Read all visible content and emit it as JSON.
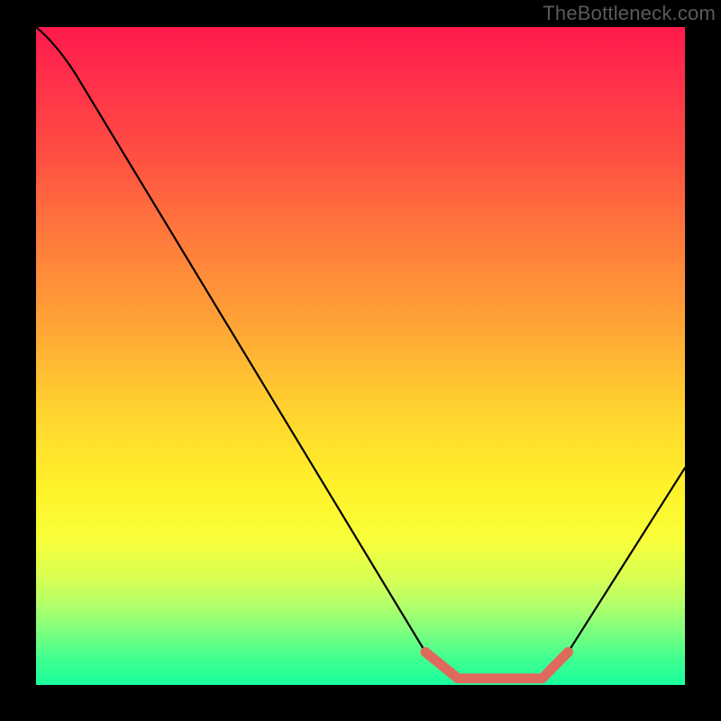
{
  "watermark": "TheBottleneck.com",
  "chart_data": {
    "type": "line",
    "title": "",
    "xlabel": "",
    "ylabel": "",
    "ylim": [
      0,
      100
    ],
    "xlim": [
      0,
      100
    ],
    "series": [
      {
        "name": "curve",
        "color": "#000000",
        "x": [
          0,
          6,
          60,
          65,
          78,
          82,
          100
        ],
        "values": [
          100,
          93,
          5,
          1,
          1,
          5,
          33
        ]
      },
      {
        "name": "highlight",
        "color": "#e0695e",
        "x": [
          60,
          65,
          78,
          82
        ],
        "values": [
          5,
          1,
          1,
          5
        ]
      }
    ],
    "gradient_stops": [
      {
        "pct": 0,
        "color": "#ff1a4d"
      },
      {
        "pct": 20,
        "color": "#ff5142"
      },
      {
        "pct": 45,
        "color": "#ffa336"
      },
      {
        "pct": 70,
        "color": "#fff22a"
      },
      {
        "pct": 88,
        "color": "#b0ff6a"
      },
      {
        "pct": 100,
        "color": "#1aff9e"
      }
    ]
  }
}
